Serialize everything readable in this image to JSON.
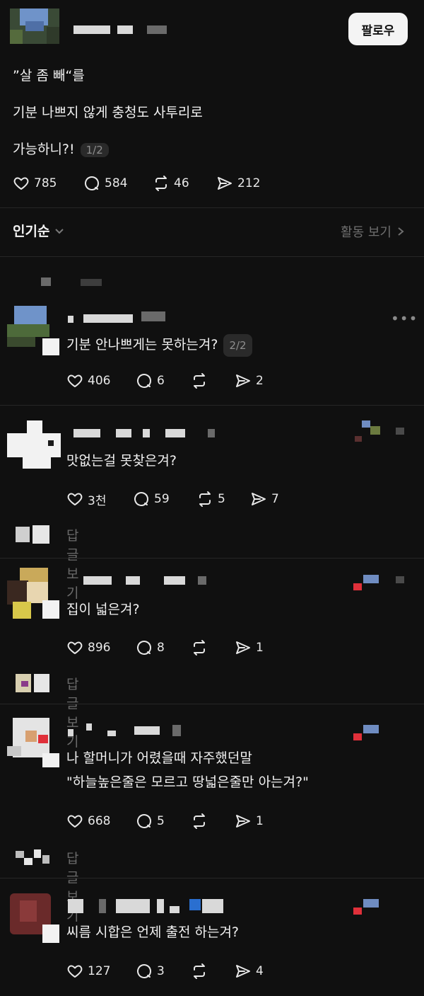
{
  "post": {
    "follow_label": "팔로우",
    "lines": [
      "”살 좀 빼“를",
      "기분 나쁘지 않게  충청도 사투리로",
      "가능하니?!"
    ],
    "pager": "1/2",
    "stats": {
      "likes": "785",
      "comments": "584",
      "reposts": "46",
      "shares": "212"
    }
  },
  "sort": {
    "label": "인기순",
    "activity_label": "활동 보기"
  },
  "comments": [
    {
      "text": "기분 안나쁘게는 못하는겨?",
      "pager": "2/2",
      "likes": "406",
      "comments": "6",
      "reposts": "",
      "shares": "2",
      "reply_label": ""
    },
    {
      "text": "맛없는걸 못찾은겨?",
      "likes": "3천",
      "comments": "59",
      "reposts": "5",
      "shares": "7",
      "reply_label": "답글 보기"
    },
    {
      "text": "집이 넓은겨?",
      "likes": "896",
      "comments": "8",
      "reposts": "",
      "shares": "1",
      "reply_label": "답글 보기"
    },
    {
      "line1": "나 할머니가 어렸을때 자주했던말",
      "line2": "\"하늘높은줄은 모르고 땅넓은줄만 아는겨?\"",
      "likes": "668",
      "comments": "5",
      "reposts": "",
      "shares": "1",
      "reply_label": "답글 보기"
    },
    {
      "text": "씨름 시합은 언제 출전 하는겨?",
      "likes": "127",
      "comments": "3",
      "reposts": "",
      "shares": "4"
    }
  ],
  "icons": [
    "heart-icon",
    "comment-icon",
    "repost-icon",
    "share-icon",
    "chevron-down-icon",
    "chevron-right-icon",
    "more-icon"
  ],
  "colors": {
    "background": "#101010",
    "text": "#f3f3f3",
    "muted": "#6e6e6e",
    "button_bg": "#f4f4f4"
  }
}
